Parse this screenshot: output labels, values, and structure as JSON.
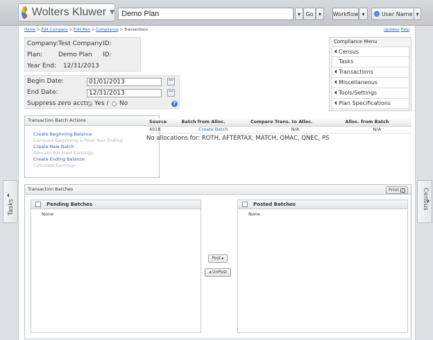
{
  "header": {
    "brand": "Wolters Kluwer",
    "plan_name": "Demo Plan",
    "go_label": "Go",
    "workflow_label": "Workflow",
    "user_label": "User Name"
  },
  "breadcrumb": {
    "home": "Home",
    "edit_company": "Edit Company",
    "edit_plan": "Edit Plan",
    "compliance": "Compliance",
    "current": "Transactions"
  },
  "top_links": {
    "updates": "Updates",
    "help": "Help"
  },
  "plan_info": {
    "company_label": "Company:",
    "company": "Test Company",
    "company_id_label": "ID:",
    "plan_label": "Plan:",
    "plan": "Demo Plan",
    "plan_id_label": "ID:",
    "year_end_label": "Year End:",
    "year_end": "12/31/2013"
  },
  "dates": {
    "begin_label": "Begin Date:",
    "begin_value": "01/01/2013",
    "end_label": "End Date:",
    "end_value": "12/31/2013",
    "suppress_label": "Suppress zero accts:",
    "yes_label": "Yes /",
    "no_label": "No",
    "help_glyph": "?"
  },
  "compliance_menu": {
    "title": "Compliance Menu",
    "items": [
      "Census",
      "Tasks",
      "Transactions",
      "Miscellaneous",
      "Tools/Settings",
      "Plan Specifications"
    ]
  },
  "batch_actions": {
    "title": "Transaction Batch Actions",
    "items": [
      "Create Beginning Balance",
      "Compare Beginning & Prior Year Ending",
      "Create New Batch",
      "Allocate Bal Frwd Earnings",
      "Create Ending Balance",
      "Calculate Earnings"
    ]
  },
  "alloc_table": {
    "headers": [
      "Source",
      "Batch from Alloc.",
      "Compare Trans. to Alloc.",
      "Alloc. from Batch"
    ],
    "row": [
      "401K",
      "Create Batch",
      "N/A",
      "N/A"
    ]
  },
  "no_alloc_text": "No allocations for: ROTH, AFTERTAX, MATCH, QMAC, QNEC, PS",
  "batches": {
    "title": "Transaction Batches",
    "print_label": "Print",
    "pending_title": "Pending Batches",
    "pending_body": "None",
    "posted_title": "Posted Batches",
    "posted_body": "None",
    "post_label": "Post ▸",
    "unpost_label": "◂ UnPost"
  },
  "side_tabs": {
    "left": "Tasks",
    "right": "Census"
  }
}
